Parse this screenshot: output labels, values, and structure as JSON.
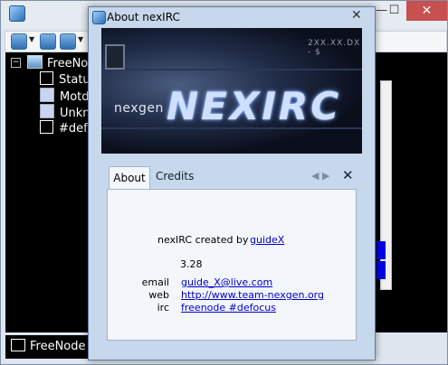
{
  "main_window": {
    "minimize_glyph": "—",
    "maximize_glyph": "☐",
    "close_glyph": "✕"
  },
  "tree": {
    "expander_glyph": "−",
    "network": "FreeNode",
    "items": [
      "Status",
      "Motd",
      "Unknown",
      "#defocus"
    ]
  },
  "status_bar": {
    "label": "FreeNode"
  },
  "dialog": {
    "title": "About nexIRC",
    "close_glyph": "✕",
    "banner": {
      "brand": "nexgen",
      "product": "NEXIRC",
      "code": "2XX.XX.DX - $"
    },
    "tabs": [
      {
        "label": "About",
        "active": true
      },
      {
        "label": "Credits",
        "active": false
      }
    ],
    "tab_nav_prev": "◀",
    "tab_nav_next": "▶",
    "tab_close": "✕",
    "about": {
      "created_by_label": "nexIRC created by",
      "author": "guideX",
      "version": "3.28",
      "email_label": "email",
      "email": "guide_X@live.com",
      "web_label": "web",
      "web": "http://www.team-nexgen.org",
      "irc_label": "irc",
      "irc": "freenode #defocus"
    }
  }
}
